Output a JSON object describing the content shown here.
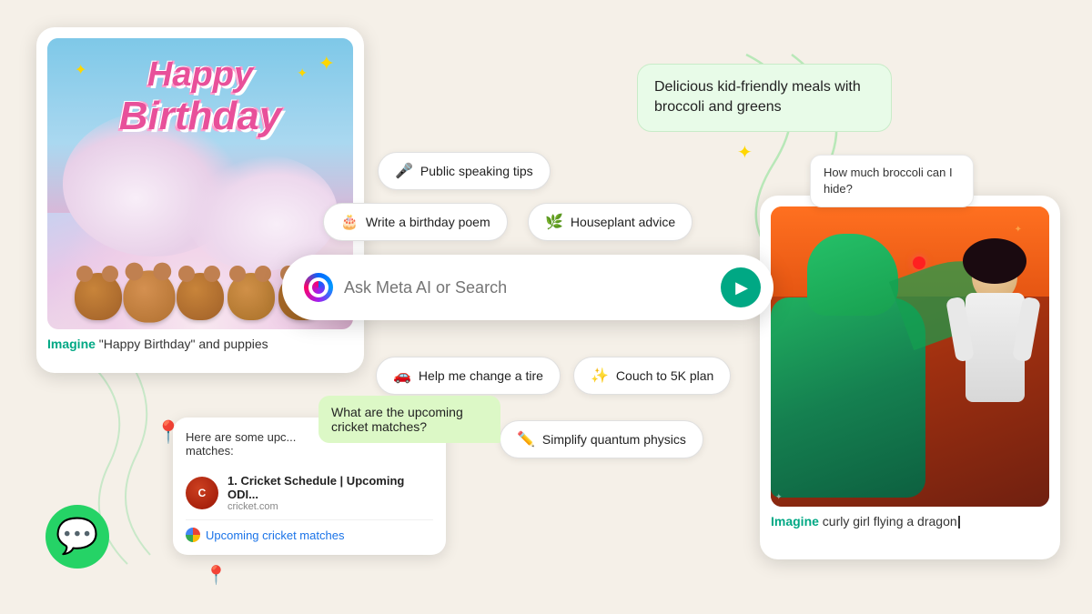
{
  "app": {
    "background_color": "#f5f0e8"
  },
  "search": {
    "placeholder": "Ask Meta AI or Search"
  },
  "pills": [
    {
      "id": "public-speaking",
      "emoji": "🎤",
      "label": "Public speaking tips"
    },
    {
      "id": "birthday-poem",
      "emoji": "🎂",
      "label": "Write a birthday poem"
    },
    {
      "id": "houseplant",
      "emoji": "🌿",
      "label": "Houseplant advice"
    },
    {
      "id": "change-tire",
      "emoji": "🚗",
      "label": "Help me change a tire"
    },
    {
      "id": "couch-5k",
      "emoji": "✨",
      "label": "Couch to 5K plan"
    },
    {
      "id": "quantum",
      "emoji": "✏️",
      "label": "Simplify quantum physics"
    }
  ],
  "chat_bubbles": [
    {
      "id": "broccoli-main",
      "text": "Delicious kid-friendly meals\nwith broccoli and greens"
    },
    {
      "id": "broccoli-small",
      "text": "How much broccoli\ncan I hide?"
    }
  ],
  "birthday_card": {
    "text": "Happy Birthday",
    "caption_imagine": "Imagine",
    "caption_rest": " \"Happy Birthday\" and puppies"
  },
  "dragon_card": {
    "caption_imagine": "Imagine",
    "caption_rest": " curly girl flying a dragon"
  },
  "cricket": {
    "question": "What are the upcoming\ncricket matches?",
    "result_intro": "Here are some upc...\nmatches:",
    "result_title": "1. Cricket Schedule | Upcoming ODI...",
    "result_url": "cricket.com",
    "google_link": "Upcoming cricket matches"
  }
}
